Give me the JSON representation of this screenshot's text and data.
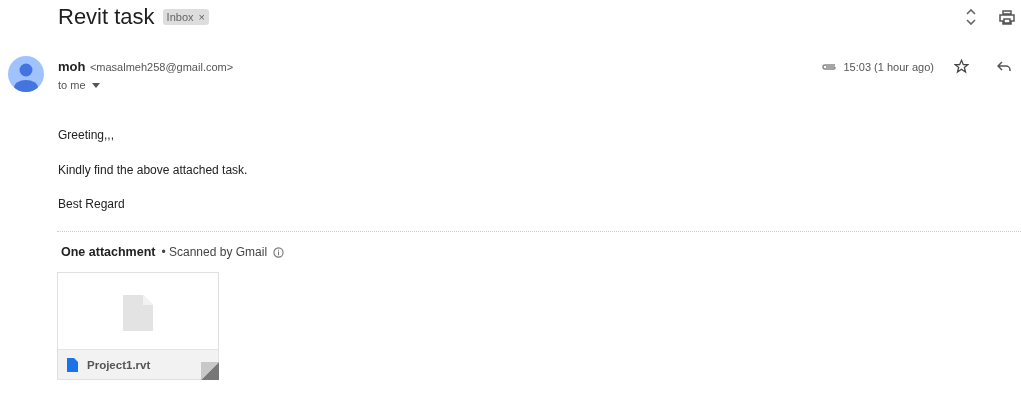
{
  "subject": "Revit task",
  "label": {
    "text": "Inbox",
    "close": "×"
  },
  "sender": {
    "name": "moh",
    "email": "<masalmeh258@gmail.com>",
    "recipient": "to me"
  },
  "time": "15:03 (1 hour ago)",
  "starred": false,
  "body": [
    "Greeting,,,",
    "Kindly find the above attached task.",
    "Best Regard"
  ],
  "attachments_header": {
    "title": "One attachment",
    "scan_note": "• Scanned by Gmail"
  },
  "attachments": [
    {
      "name": "Project1.rvt"
    }
  ]
}
